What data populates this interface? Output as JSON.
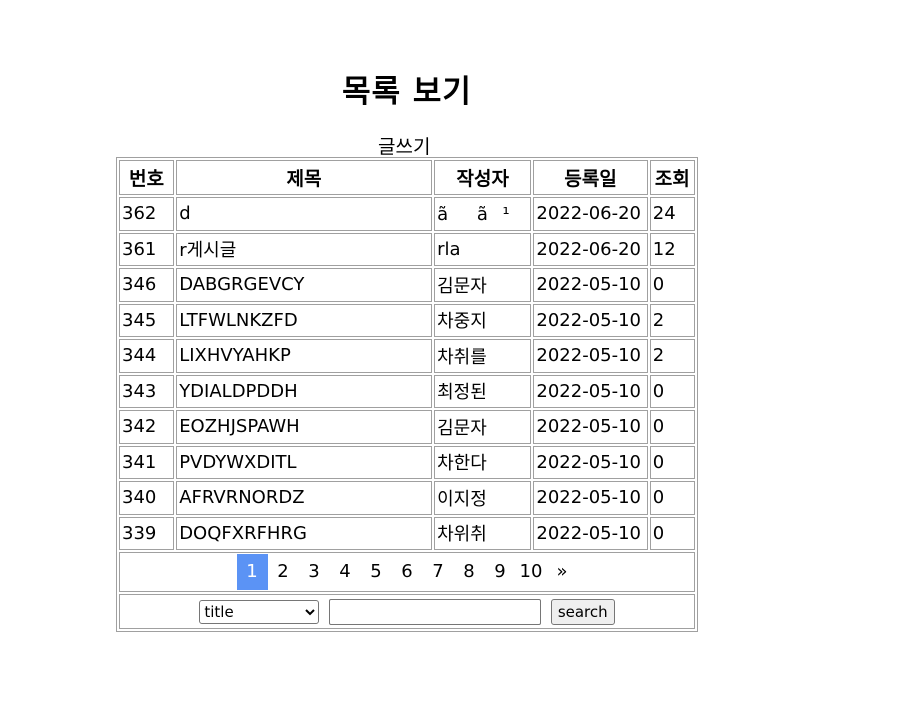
{
  "header": {
    "title": "목록 보기",
    "write_label": "글쓰기"
  },
  "table": {
    "columns": [
      "번호",
      "제목",
      "작성자",
      "등록일",
      "조회"
    ],
    "rows": [
      {
        "no": "362",
        "title": "d",
        "author": "ãã¹",
        "date": "2022-06-20",
        "views": "24"
      },
      {
        "no": "361",
        "title": "r게시글",
        "author": "rla",
        "date": "2022-06-20",
        "views": "12"
      },
      {
        "no": "346",
        "title": "DABGRGEVCY",
        "author": "김문자",
        "date": "2022-05-10",
        "views": "0"
      },
      {
        "no": "345",
        "title": "LTFWLNKZFD",
        "author": "차중지",
        "date": "2022-05-10",
        "views": "2"
      },
      {
        "no": "344",
        "title": "LIXHVYAHKP",
        "author": "차취를",
        "date": "2022-05-10",
        "views": "2"
      },
      {
        "no": "343",
        "title": "YDIALDPDDH",
        "author": "최정된",
        "date": "2022-05-10",
        "views": "0"
      },
      {
        "no": "342",
        "title": "EOZHJSPAWH",
        "author": "김문자",
        "date": "2022-05-10",
        "views": "0"
      },
      {
        "no": "341",
        "title": "PVDYWXDITL",
        "author": "차한다",
        "date": "2022-05-10",
        "views": "0"
      },
      {
        "no": "340",
        "title": "AFRVRNORDZ",
        "author": "이지정",
        "date": "2022-05-10",
        "views": "0"
      },
      {
        "no": "339",
        "title": "DOQFXRFHRG",
        "author": "차위취",
        "date": "2022-05-10",
        "views": "0"
      }
    ]
  },
  "pagination": {
    "pages": [
      "1",
      "2",
      "3",
      "4",
      "5",
      "6",
      "7",
      "8",
      "9",
      "10"
    ],
    "current": "1",
    "next_label": "»",
    "active_color": "#5b93f5"
  },
  "search": {
    "field_selected": "title",
    "query_value": "",
    "button_label": "search"
  }
}
